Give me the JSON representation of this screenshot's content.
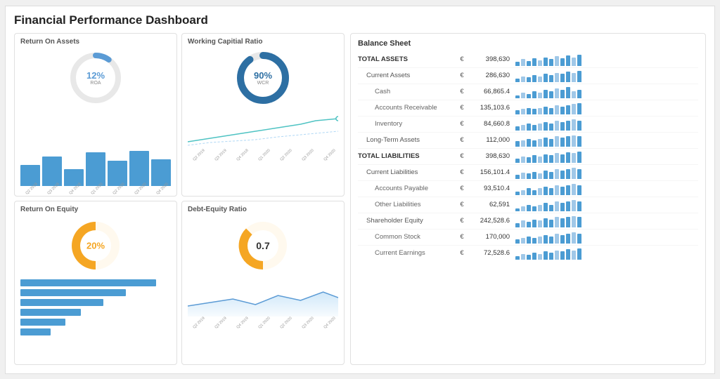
{
  "title": "Financial Performance Dashboard",
  "panels": {
    "roa": {
      "title": "Return On Assets",
      "value": "12%",
      "sub": "ROA",
      "color": "#5b9bd5",
      "bars": [
        25,
        35,
        20,
        40,
        30,
        50,
        38
      ],
      "labels": [
        "Q2 2019",
        "Q3 2019",
        "Q4 2019",
        "Q1 2020",
        "Q2 2020",
        "Q3 2020",
        "Q4 2020"
      ]
    },
    "wcr": {
      "title": "Working Capitial Ratio",
      "value": "90%",
      "sub": "WCR",
      "color": "#2d6fa3",
      "labels": [
        "Q2 2019",
        "Q3 2019",
        "Q4 2018",
        "Q1 2020",
        "Q2 2020",
        "Q3 2020",
        "Q4 2020"
      ]
    },
    "roe": {
      "title": "Return On Equity",
      "value": "20%",
      "color": "#f5a623",
      "hbars": [
        90,
        70,
        55,
        40,
        30,
        20
      ]
    },
    "der": {
      "title": "Debt-Equity Ratio",
      "value": "0.7",
      "color": "#f5a623",
      "labels": [
        "Q2 2019",
        "Q3 2019",
        "Q4 2019",
        "Q1 2020",
        "Q2 2020",
        "Q3 2020",
        "Q4 2020"
      ]
    }
  },
  "balance_sheet": {
    "title": "Balance Sheet",
    "rows": [
      {
        "label": "TOTAL ASSETS",
        "indent": 0,
        "bold": true,
        "currency": "€",
        "value": "398,630",
        "spark": [
          8,
          14,
          10,
          16,
          12,
          18,
          14,
          20,
          16,
          22,
          18,
          24
        ]
      },
      {
        "label": "Current Assets",
        "indent": 1,
        "bold": false,
        "currency": "€",
        "value": "286,630",
        "spark": [
          6,
          10,
          8,
          12,
          10,
          14,
          12,
          16,
          14,
          18,
          16,
          20
        ]
      },
      {
        "label": "Cash",
        "indent": 2,
        "bold": false,
        "currency": "€",
        "value": "66,865.4",
        "spark": [
          4,
          8,
          6,
          10,
          8,
          12,
          10,
          14,
          12,
          16,
          10,
          12
        ]
      },
      {
        "label": "Accounts Receivable",
        "indent": 2,
        "bold": false,
        "currency": "€",
        "value": "135,103.6",
        "spark": [
          6,
          8,
          10,
          8,
          10,
          12,
          10,
          14,
          12,
          14,
          16,
          18
        ]
      },
      {
        "label": "Inventory",
        "indent": 2,
        "bold": false,
        "currency": "€",
        "value": "84,660.8",
        "spark": [
          5,
          7,
          9,
          7,
          9,
          11,
          9,
          13,
          11,
          13,
          15,
          13
        ]
      },
      {
        "label": "Long-Term Assets",
        "indent": 1,
        "bold": false,
        "currency": "€",
        "value": "112,000",
        "spark": [
          8,
          10,
          12,
          10,
          12,
          14,
          12,
          16,
          14,
          16,
          18,
          16
        ]
      },
      {
        "label": "TOTAL LIABILITIES",
        "indent": 0,
        "bold": true,
        "currency": "€",
        "value": "398,630",
        "spark": [
          8,
          12,
          10,
          14,
          12,
          16,
          14,
          18,
          16,
          20,
          18,
          22
        ]
      },
      {
        "label": "Current Liabilities",
        "indent": 1,
        "bold": false,
        "currency": "€",
        "value": "156,101.4",
        "spark": [
          6,
          9,
          8,
          10,
          8,
          12,
          10,
          14,
          12,
          14,
          16,
          14
        ]
      },
      {
        "label": "Accounts Payable",
        "indent": 2,
        "bold": false,
        "currency": "€",
        "value": "93,510.4",
        "spark": [
          4,
          6,
          8,
          6,
          8,
          10,
          8,
          12,
          10,
          12,
          14,
          12
        ]
      },
      {
        "label": "Other Liabilities",
        "indent": 2,
        "bold": false,
        "currency": "€",
        "value": "62,591",
        "spark": [
          3,
          5,
          7,
          5,
          7,
          9,
          7,
          11,
          9,
          11,
          13,
          11
        ]
      },
      {
        "label": "Shareholder Equity",
        "indent": 1,
        "bold": false,
        "currency": "€",
        "value": "242,528.6",
        "spark": [
          7,
          11,
          9,
          13,
          11,
          15,
          13,
          17,
          15,
          17,
          19,
          17
        ]
      },
      {
        "label": "Common Stock",
        "indent": 2,
        "bold": false,
        "currency": "€",
        "value": "170,000",
        "spark": [
          6,
          8,
          10,
          8,
          10,
          12,
          10,
          14,
          12,
          14,
          16,
          14
        ]
      },
      {
        "label": "Current Earnings",
        "indent": 2,
        "bold": false,
        "currency": "€",
        "value": "72,528.6",
        "spark": [
          3,
          5,
          4,
          6,
          5,
          7,
          6,
          8,
          7,
          9,
          8,
          10
        ]
      }
    ]
  }
}
